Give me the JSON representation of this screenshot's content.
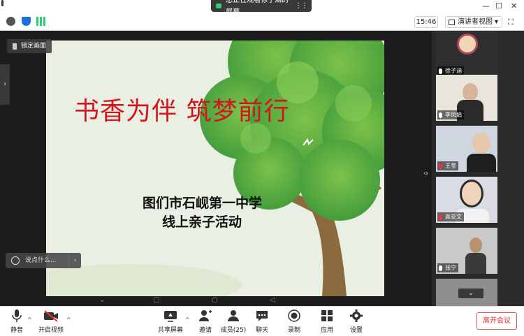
{
  "titlebar": {
    "share_banner": "您正在观看徐子涵的屏幕",
    "menu_glyph": "⋮⋮",
    "minimize": "—",
    "maximize": "☐",
    "close": "✕"
  },
  "infobar": {
    "time": "15:46",
    "view_mode": "演讲者视图",
    "view_caret": "▾",
    "fullscreen_glyph": "⛶"
  },
  "stage": {
    "lock_label": "锁定画面",
    "left_arrow": "›",
    "right_arrow": "›",
    "chat_placeholder": "说点什么...",
    "chat_collapse": "‹",
    "phone_nav": {
      "down": "⌄",
      "square": "▢",
      "circle": "○",
      "back": "◁"
    }
  },
  "slide": {
    "title": "书香为伴  筑梦前行",
    "subtitle_line1": "图们市石岘第一中学",
    "subtitle_line2": "线上亲子活动"
  },
  "participants": [
    {
      "name": "徐子涵",
      "mic_muted": false
    },
    {
      "name": "李凤娟",
      "mic_muted": false
    },
    {
      "name": "王莹",
      "mic_muted": true
    },
    {
      "name": "高亚文",
      "mic_muted": true
    },
    {
      "name": "张宁",
      "mic_muted": false
    }
  ],
  "rail": {
    "left_arrow": "‹",
    "down_arrow": "⌄"
  },
  "toolbar": {
    "mute": "静音",
    "video": "开启视频",
    "share": "共享屏幕",
    "invite": "邀请",
    "members": "成员(25)",
    "chat": "聊天",
    "record": "录制",
    "apps": "应用",
    "settings": "设置",
    "leave": "离开会议",
    "caret": "^"
  },
  "colors": {
    "accent_red": "#d1171b",
    "leave_red": "#e03030",
    "mic_green": "#2ecc71"
  }
}
